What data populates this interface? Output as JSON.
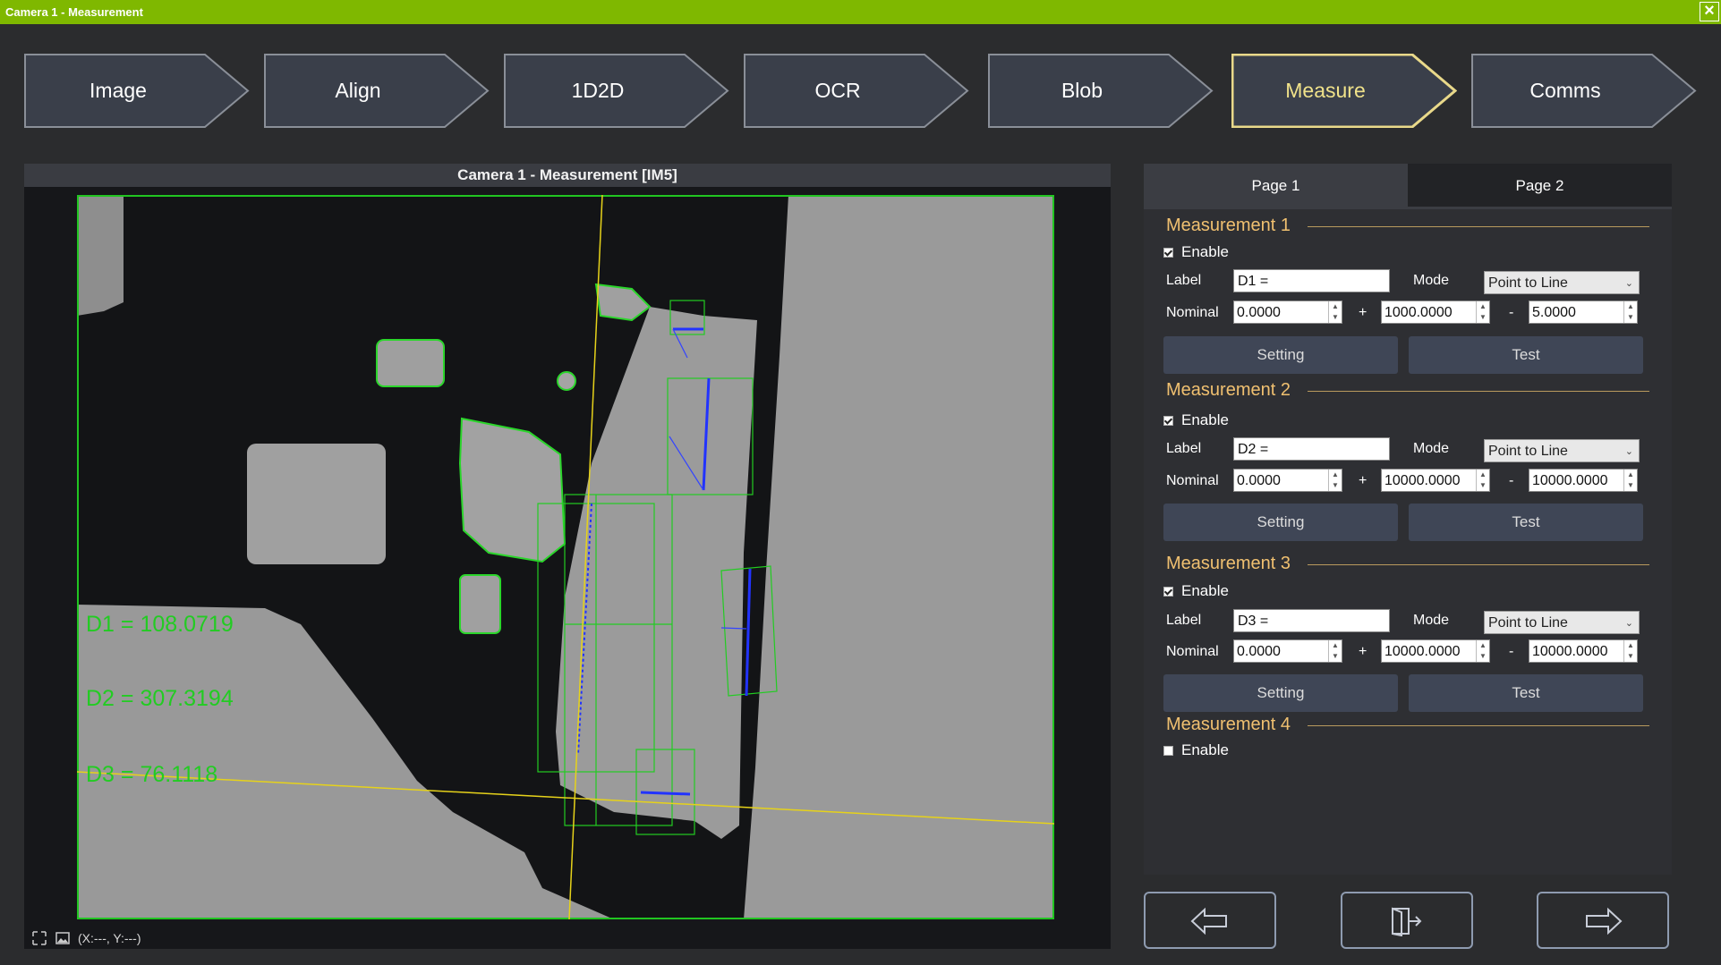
{
  "window": {
    "title": "Camera 1 - Measurement",
    "close_icon": "close-icon"
  },
  "steps": [
    {
      "label": "Image"
    },
    {
      "label": "Align"
    },
    {
      "label": "1D2D"
    },
    {
      "label": "OCR"
    },
    {
      "label": "Blob"
    },
    {
      "label": "Measure",
      "active": true
    },
    {
      "label": "Comms"
    }
  ],
  "viewer": {
    "title": "Camera 1 -  Measurement  [IM5]",
    "coords": "(X:---, Y:---)",
    "overlay": [
      "D1 = 108.0719",
      "D2 = 307.3194",
      "D3 = 76.1118"
    ]
  },
  "tabs": [
    {
      "label": "Page 1",
      "selected": true
    },
    {
      "label": "Page 2"
    }
  ],
  "labels": {
    "enable": "Enable",
    "label": "Label",
    "mode": "Mode",
    "nominal": "Nominal",
    "plus": "+",
    "minus": "-",
    "setting": "Setting",
    "test": "Test"
  },
  "measurements": [
    {
      "title": "Measurement 1",
      "enabled": true,
      "label": "D1 =",
      "mode": "Point to Line",
      "nominal": "0.0000",
      "plus": "1000.0000",
      "minus": "5.0000"
    },
    {
      "title": "Measurement 2",
      "enabled": true,
      "label": "D2 =",
      "mode": "Point to Line",
      "nominal": "0.0000",
      "plus": "10000.0000",
      "minus": "10000.0000"
    },
    {
      "title": "Measurement 3",
      "enabled": true,
      "label": "D3 =",
      "mode": "Point to Line",
      "nominal": "0.0000",
      "plus": "10000.0000",
      "minus": "10000.0000"
    },
    {
      "title": "Measurement 4",
      "enabled": false
    }
  ],
  "colors": {
    "title_bar": "#7fb800",
    "accent_active": "#f0e28a",
    "section_title": "#f0c070",
    "overlay_green": "#22cc22",
    "overlay_yellow": "#e6d21a",
    "edge_blue": "#2233ff"
  },
  "nav": {
    "back_icon": "arrow-left-icon",
    "exit_icon": "exit-door-icon",
    "next_icon": "arrow-right-icon"
  }
}
